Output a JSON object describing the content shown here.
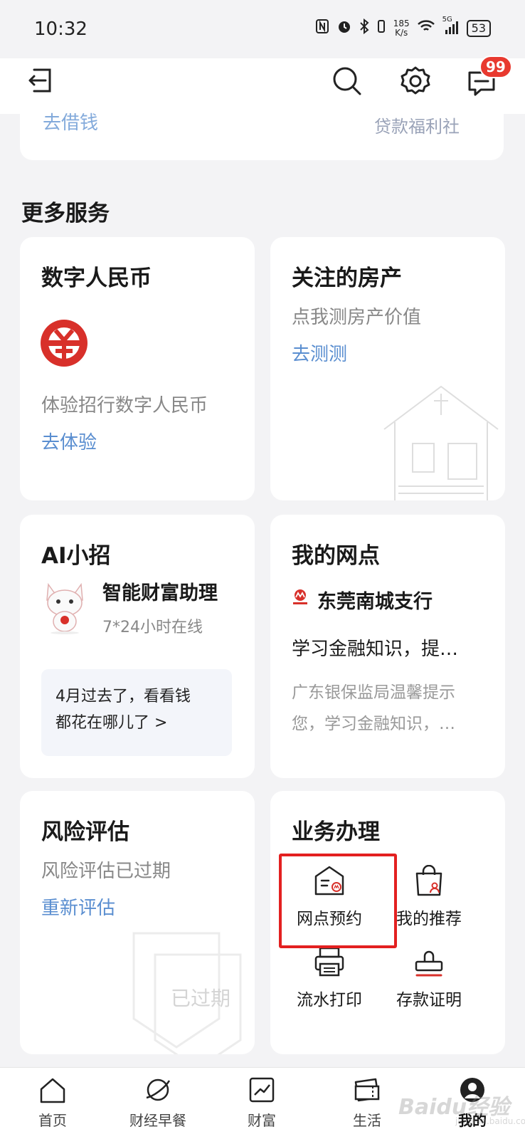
{
  "status_bar": {
    "time": "10:32",
    "speed_top": "185",
    "speed_bottom": "K/s",
    "network": "5G",
    "battery": "53"
  },
  "top_bar": {
    "notification_count": "99"
  },
  "partial_card": {
    "left_link": "去借钱",
    "right_text": "贷款福利社"
  },
  "more_services": {
    "title": "更多服务"
  },
  "digital_rmb": {
    "title": "数字人民币",
    "subtitle": "体验招行数字人民币",
    "link": "去体验"
  },
  "property": {
    "title": "关注的房产",
    "subtitle": "点我测房产价值",
    "link": "去测测"
  },
  "ai": {
    "title": "AI小招",
    "assistant_name": "智能财富助理",
    "assistant_sub": "7*24小时在线",
    "bubble_line1": "4月过去了，看看钱",
    "bubble_line2": "都花在哪儿了 >"
  },
  "branch": {
    "title": "我的网点",
    "name": "东莞南城支行",
    "headline": "学习金融知识，提…",
    "desc_line1": "广东银保监局温馨提示",
    "desc_line2": "您，学习金融知识，…"
  },
  "risk": {
    "title": "风险评估",
    "subtitle": "风险评估已过期",
    "link": "重新评估",
    "stamp": "已过期"
  },
  "business": {
    "title": "业务办理",
    "items": [
      {
        "label": "网点预约",
        "icon": "branch-appointment-icon"
      },
      {
        "label": "我的推荐",
        "icon": "recommend-icon"
      },
      {
        "label": "流水打印",
        "icon": "printer-icon"
      },
      {
        "label": "存款证明",
        "icon": "stamp-icon"
      }
    ]
  },
  "bottom_nav": {
    "items": [
      {
        "label": "首页",
        "icon": "home-icon"
      },
      {
        "label": "财经早餐",
        "icon": "planet-icon"
      },
      {
        "label": "财富",
        "icon": "chart-icon"
      },
      {
        "label": "生活",
        "icon": "ticket-icon"
      },
      {
        "label": "我的",
        "icon": "profile-icon"
      }
    ]
  },
  "watermark": {
    "brand": "Baidu经验",
    "url": "jingyan.baidu.com"
  },
  "colors": {
    "accent_link": "#5a8ed0",
    "brand_red": "#d8302a",
    "highlight": "#e32020"
  }
}
